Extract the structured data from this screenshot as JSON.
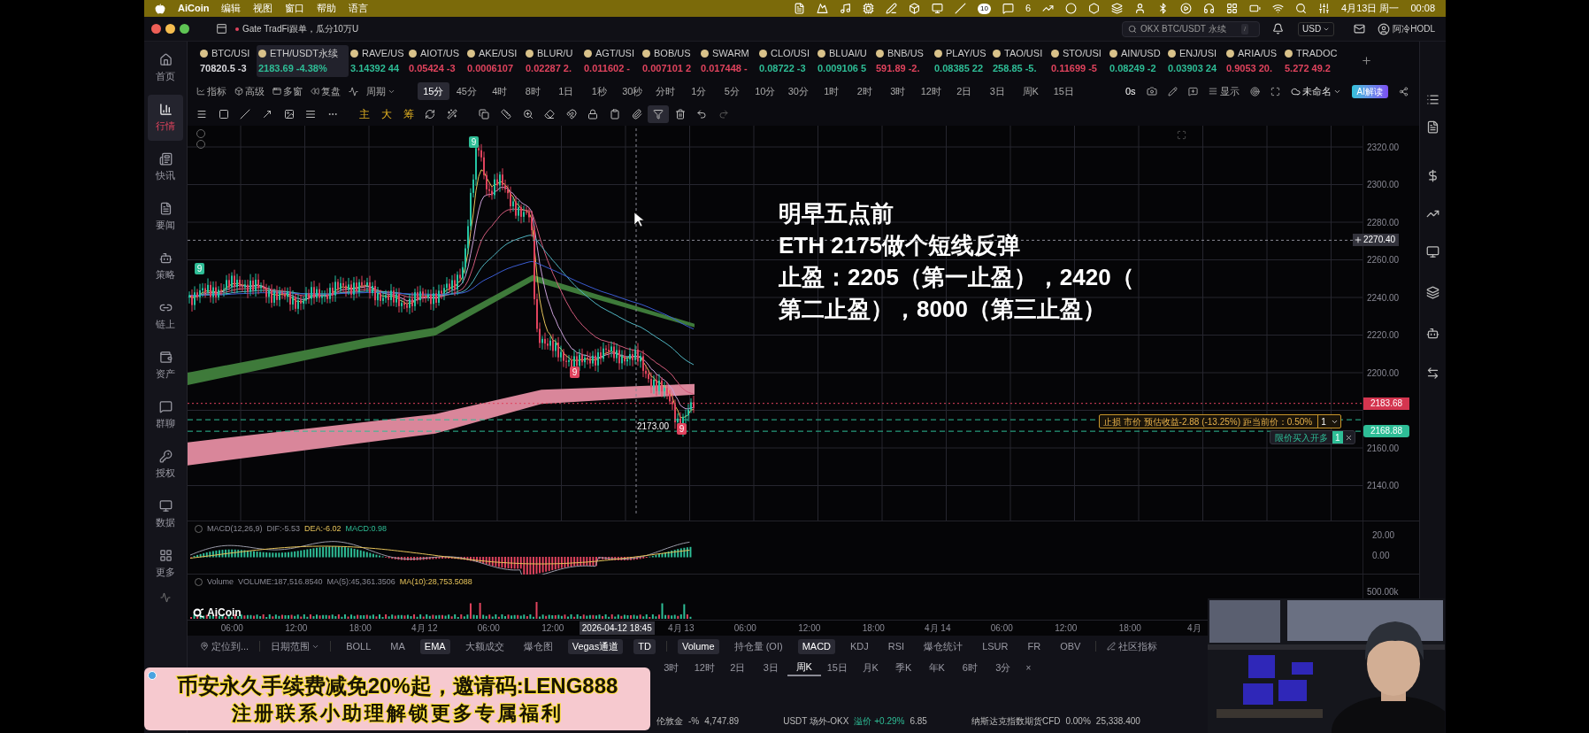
{
  "menu_bar": {
    "app": "AiCoin",
    "menus": [
      "编辑",
      "视图",
      "窗口",
      "帮助",
      "语言"
    ],
    "calendar_badge": "10",
    "wechat_badge": "6",
    "date": "4月13日 周一",
    "time": "00:08"
  },
  "title_bar": {
    "notice": "Gate TradFi跟单，瓜分10万U",
    "search_placeholder": "OKX BTC/USDT 永续",
    "search_shortcut": "/",
    "currency": "USD",
    "user": "阿冷HODL"
  },
  "sidebar": [
    {
      "label": "首页",
      "selected": false
    },
    {
      "label": "行情",
      "selected": true
    },
    {
      "label": "快讯",
      "selected": false
    },
    {
      "label": "要闻",
      "selected": false
    },
    {
      "label": "策略",
      "selected": false
    },
    {
      "label": "链上",
      "selected": false
    },
    {
      "label": "资产",
      "selected": false
    },
    {
      "label": "群聊",
      "selected": false
    },
    {
      "label": "授权",
      "selected": false
    },
    {
      "label": "数据",
      "selected": false
    },
    {
      "label": "更多",
      "selected": false
    }
  ],
  "tickers": [
    {
      "symbol": "BTC/USI",
      "price": "70820.5 -3",
      "color": "#d8d8dc",
      "selected": false
    },
    {
      "symbol": "ETH/USDT永续",
      "price": "2183.69 -4.38%",
      "color": "#2ebd96",
      "selected": true
    },
    {
      "symbol": "RAVE/US",
      "price": "3.14392 44",
      "color": "#2ebd96",
      "selected": false
    },
    {
      "symbol": "AIOT/US",
      "price": "0.05424 -3",
      "color": "#e0435d",
      "selected": false
    },
    {
      "symbol": "AKE/USI",
      "price": "0.0006107",
      "color": "#e0435d",
      "selected": false
    },
    {
      "symbol": "BLUR/U",
      "price": "0.02287 2.",
      "color": "#e0435d",
      "selected": false
    },
    {
      "symbol": "AGT/USI",
      "price": "0.011602 -",
      "color": "#e0435d",
      "selected": false
    },
    {
      "symbol": "BOB/US",
      "price": "0.007101 2",
      "color": "#e0435d",
      "selected": false
    },
    {
      "symbol": "SWARM",
      "price": "0.017448 -",
      "color": "#e0435d",
      "selected": false
    },
    {
      "symbol": "CLO/USI",
      "price": "0.08722 -3",
      "color": "#2ebd96",
      "selected": false
    },
    {
      "symbol": "BLUAI/U",
      "price": "0.009106 5",
      "color": "#2ebd96",
      "selected": false
    },
    {
      "symbol": "BNB/US",
      "price": "591.89 -2.",
      "color": "#e0435d",
      "selected": false
    },
    {
      "symbol": "PLAY/US",
      "price": "0.08385 22",
      "color": "#2ebd96",
      "selected": false
    },
    {
      "symbol": "TAO/USI",
      "price": "258.85 -5.",
      "color": "#2ebd96",
      "selected": false
    },
    {
      "symbol": "STO/USI",
      "price": "0.11699 -5",
      "color": "#e0435d",
      "selected": false
    },
    {
      "symbol": "AIN/USD",
      "price": "0.08249 -2",
      "color": "#2ebd96",
      "selected": false
    },
    {
      "symbol": "ENJ/USI",
      "price": "0.03903 24",
      "color": "#2ebd96",
      "selected": false
    },
    {
      "symbol": "ARIA/US",
      "price": "0.9053 20.",
      "color": "#e0435d",
      "selected": false
    },
    {
      "symbol": "TRADOC",
      "price": "5.272 49.2",
      "color": "#e0435d",
      "selected": false
    }
  ],
  "period_toolbar": {
    "tools": [
      "指标",
      "高级",
      "多窗",
      "复盘"
    ],
    "period_menu": "周期",
    "periods": [
      {
        "label": "15分",
        "selected": true
      },
      {
        "label": "45分",
        "selected": false
      },
      {
        "label": "4时",
        "selected": false
      },
      {
        "label": "8时",
        "selected": false
      },
      {
        "label": "1日",
        "selected": false
      },
      {
        "label": "1秒",
        "selected": false
      },
      {
        "label": "30秒",
        "selected": false
      },
      {
        "label": "分时",
        "selected": false
      },
      {
        "label": "1分",
        "selected": false
      },
      {
        "label": "5分",
        "selected": false
      },
      {
        "label": "10分",
        "selected": false
      },
      {
        "label": "30分",
        "selected": false
      },
      {
        "label": "1时",
        "selected": false
      },
      {
        "label": "2时",
        "selected": false
      },
      {
        "label": "3时",
        "selected": false
      },
      {
        "label": "12时",
        "selected": false
      },
      {
        "label": "2日",
        "selected": false
      },
      {
        "label": "3日",
        "selected": false
      },
      {
        "label": "周K",
        "selected": false
      },
      {
        "label": "15日",
        "selected": false
      }
    ],
    "countdown": "0s",
    "display": "显示",
    "layout": "未命名",
    "ai": "AI解读"
  },
  "draw_toolbar": {
    "marks": [
      "主",
      "大",
      "筹"
    ]
  },
  "annotation": [
    "明早五点前",
    "ETH 2175做个短线反弹",
    "止盈：2205（第一止盈），2420（",
    "第二止盈），8000（第三止盈）"
  ],
  "chart": {
    "td_marks": [
      {
        "label": "9",
        "kind": "buy"
      },
      {
        "label": "9",
        "kind": "buy"
      },
      {
        "label": "9",
        "kind": "sell"
      },
      {
        "label": "9",
        "kind": "sell"
      }
    ],
    "low_label": "2173.00",
    "price_ticks": [
      "2320.00",
      "2300.00",
      "2280.00",
      "2260.00",
      "2240.00",
      "2220.00",
      "2200.00",
      "2160.00",
      "2140.00"
    ],
    "crosshair_price": "2270.40",
    "last_price": "2183.68",
    "order_price": "2168.88",
    "stop_order": {
      "text": "止损 市价 预估收益-2.88 (-13.25%) 距当前价：0.50%",
      "qty": "1"
    },
    "limit_order": {
      "text": "限价买入开多",
      "qty": "1"
    },
    "logo": "AiCoin"
  },
  "macd": {
    "title": "MACD(12,26,9)",
    "dif": "DIF:-5.53",
    "dea": "DEA:-6.02",
    "value": "MACD:0.98",
    "ticks": [
      "20.00",
      "0.00"
    ]
  },
  "volume": {
    "title": "Volume",
    "volume": "VOLUME:187,516.8540",
    "ma5": "MA(5):45,361.3506",
    "ma10": "MA(10):28,753.5088",
    "tick": "500.00k"
  },
  "time_axis": [
    {
      "label": "06:00",
      "selected": false
    },
    {
      "label": "12:00",
      "selected": false
    },
    {
      "label": "18:00",
      "selected": false
    },
    {
      "label": "4月 12",
      "selected": false
    },
    {
      "label": "06:00",
      "selected": false
    },
    {
      "label": "12:00",
      "selected": false
    },
    {
      "label": "2026-04-12 18:45",
      "selected": true
    },
    {
      "label": "4月 13",
      "selected": false
    },
    {
      "label": "06:00",
      "selected": false
    },
    {
      "label": "12:00",
      "selected": false
    },
    {
      "label": "18:00",
      "selected": false
    },
    {
      "label": "4月 14",
      "selected": false
    },
    {
      "label": "06:00",
      "selected": false
    },
    {
      "label": "12:00",
      "selected": false
    },
    {
      "label": "18:00",
      "selected": false
    },
    {
      "label": "4月",
      "selected": false
    }
  ],
  "indicator_toolbar": {
    "locate": "定位到...",
    "date_range": "日期范围",
    "indicators": [
      {
        "label": "BOLL",
        "selected": false
      },
      {
        "label": "MA",
        "selected": false
      },
      {
        "label": "EMA",
        "selected": true
      },
      {
        "label": "大额成交",
        "selected": false
      },
      {
        "label": "爆仓图",
        "selected": false
      },
      {
        "label": "Vegas通道",
        "selected": true
      },
      {
        "label": "TD",
        "selected": true
      }
    ],
    "sub_indicators": [
      {
        "label": "Volume",
        "selected": true
      },
      {
        "label": "持仓量 (OI)",
        "selected": false
      },
      {
        "label": "MACD",
        "selected": true
      },
      {
        "label": "KDJ",
        "selected": false
      },
      {
        "label": "RSI",
        "selected": false
      },
      {
        "label": "爆仓统计",
        "selected": false
      },
      {
        "label": "LSUR",
        "selected": false
      },
      {
        "label": "FR",
        "selected": false
      },
      {
        "label": "OBV",
        "selected": false
      }
    ],
    "community": "社区指标"
  },
  "period_row": [
    {
      "label": "3时",
      "selected": false
    },
    {
      "label": "12时",
      "selected": false
    },
    {
      "label": "2日",
      "selected": false
    },
    {
      "label": "3日",
      "selected": false
    },
    {
      "label": "周K",
      "selected": true
    },
    {
      "label": "15日",
      "selected": false
    },
    {
      "label": "月K",
      "selected": false
    },
    {
      "label": "季K",
      "selected": false
    },
    {
      "label": "年K",
      "selected": false
    },
    {
      "label": "6时",
      "selected": false
    },
    {
      "label": "3分",
      "selected": false
    }
  ],
  "period_row_close": "×",
  "status_bar": [
    {
      "name": "伦敦金",
      "change": "-%",
      "value": "4,747.89"
    },
    {
      "name": "USDT 场外-OKX",
      "change": "溢价 +0.29%",
      "value": "6.85",
      "color": "#2ebd96"
    },
    {
      "name": "纳斯达克指数期货CFD",
      "change": "0.00%",
      "value": "25,338.400"
    }
  ],
  "banner": [
    "币安永久手续费减免20%起，邀请码:LENG888",
    "注册联系小助理解锁更多专属福利"
  ],
  "webcam": {
    "kind": "picture"
  }
}
